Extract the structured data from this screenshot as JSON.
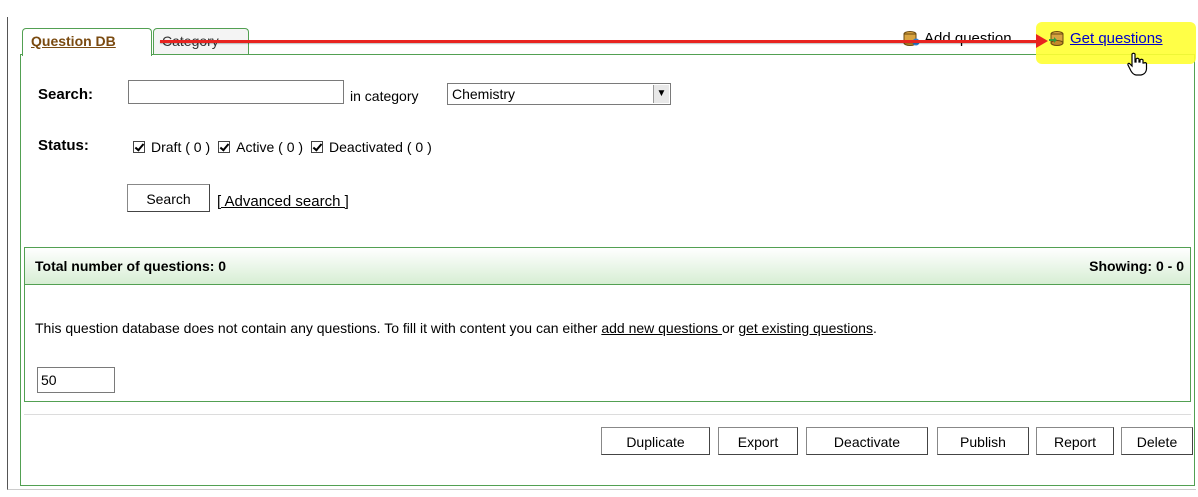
{
  "tabs": {
    "question_db": "Question DB",
    "category": "Category"
  },
  "top_actions": {
    "add_question": "Add question",
    "get_questions": "Get questions"
  },
  "search": {
    "label": "Search:",
    "value": "",
    "in_category_label": "in category",
    "category_selected": "Chemistry",
    "button": "Search",
    "advanced_link": "[ Advanced search ]"
  },
  "status": {
    "label": "Status:",
    "draft": "Draft ( 0 )",
    "active": "Active ( 0 )",
    "deactivated": "Deactivated ( 0 )"
  },
  "results": {
    "total": "Total number of questions: 0",
    "showing": "Showing: 0 - 0",
    "msg_prefix": "This question database does not contain any questions. To fill it with content you can either ",
    "add_link": "add new questions ",
    "msg_or": "or ",
    "get_link": "get existing questions",
    "msg_suffix": ".",
    "per_page": "50"
  },
  "actions": {
    "duplicate": "Duplicate",
    "export": "Export",
    "deactivate": "Deactivate",
    "publish": "Publish",
    "report": "Report",
    "delete": "Delete"
  },
  "colors": {
    "accent_green": "#52a052",
    "highlight_yellow": "#ffff33",
    "arrow_red": "#e8231f"
  }
}
